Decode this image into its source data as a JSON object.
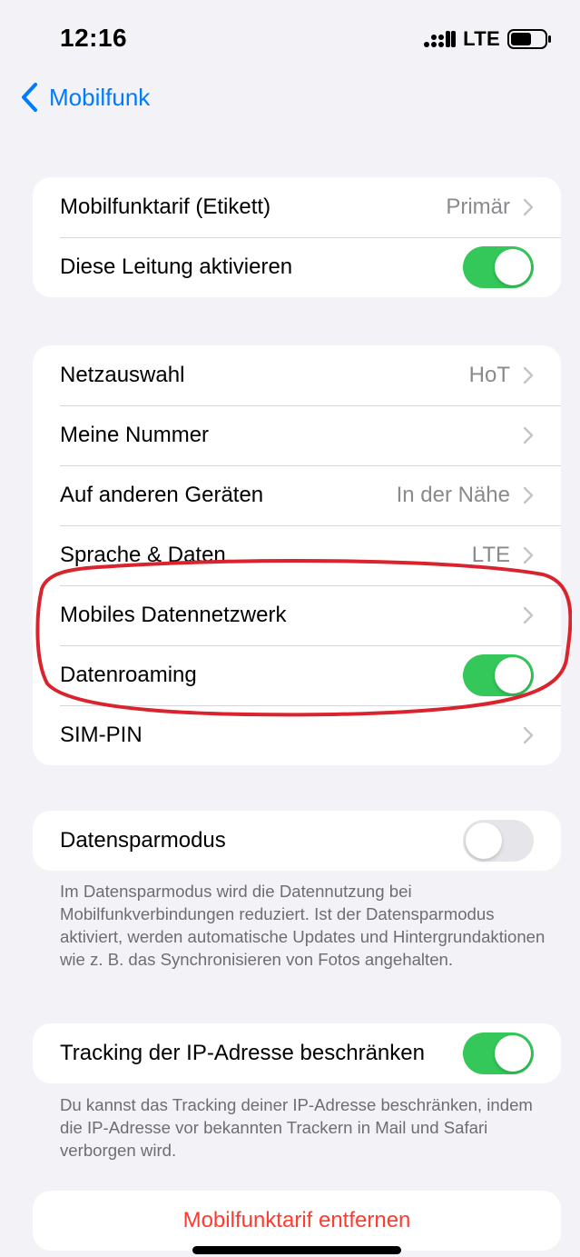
{
  "status_bar": {
    "time": "12:16",
    "network": "LTE",
    "signal_icon": "signal-bars-icon",
    "battery_icon": "battery-icon"
  },
  "nav": {
    "back_label": "Mobilfunk",
    "back_icon": "chevron-left-icon"
  },
  "group_line": {
    "rows": [
      {
        "label": "Mobilfunktarif (Etikett)",
        "value": "Primär"
      },
      {
        "label": "Diese Leitung aktivieren",
        "toggle": true
      }
    ]
  },
  "group_network": {
    "rows": [
      {
        "label": "Netzauswahl",
        "value": "HoT"
      },
      {
        "label": "Meine Nummer",
        "value": ""
      },
      {
        "label": "Auf anderen Geräten",
        "value": "In der Nähe"
      },
      {
        "label": "Sprache & Daten",
        "value": "LTE"
      },
      {
        "label": "Mobiles Datennetzwerk",
        "value": ""
      },
      {
        "label": "Datenroaming",
        "toggle": true
      },
      {
        "label": "SIM-PIN",
        "value": ""
      }
    ]
  },
  "group_datasaver": {
    "label": "Datensparmodus",
    "toggle": false,
    "footer": "Im Datensparmodus wird die Datennutzung bei Mobilfunkverbindungen reduziert. Ist der Datensparmodus aktiviert, werden automatische Updates und Hintergrundaktionen wie z. B. das Synchronisieren von Fotos angehalten."
  },
  "group_tracking": {
    "label": "Tracking der IP-Adresse beschränken",
    "toggle": true,
    "footer": "Du kannst das Tracking deiner IP-Adresse beschränken, indem die IP-Adresse vor bekannten Trackern in Mail und Safari verborgen wird."
  },
  "remove_plan": {
    "label": "Mobilfunktarif entfernen"
  },
  "colors": {
    "accent": "#007aff",
    "toggle_on": "#34c759",
    "toggle_off": "#e5e5ea",
    "destructive": "#ff3b30",
    "annotation": "#d9232d",
    "background": "#f2f2f7"
  }
}
